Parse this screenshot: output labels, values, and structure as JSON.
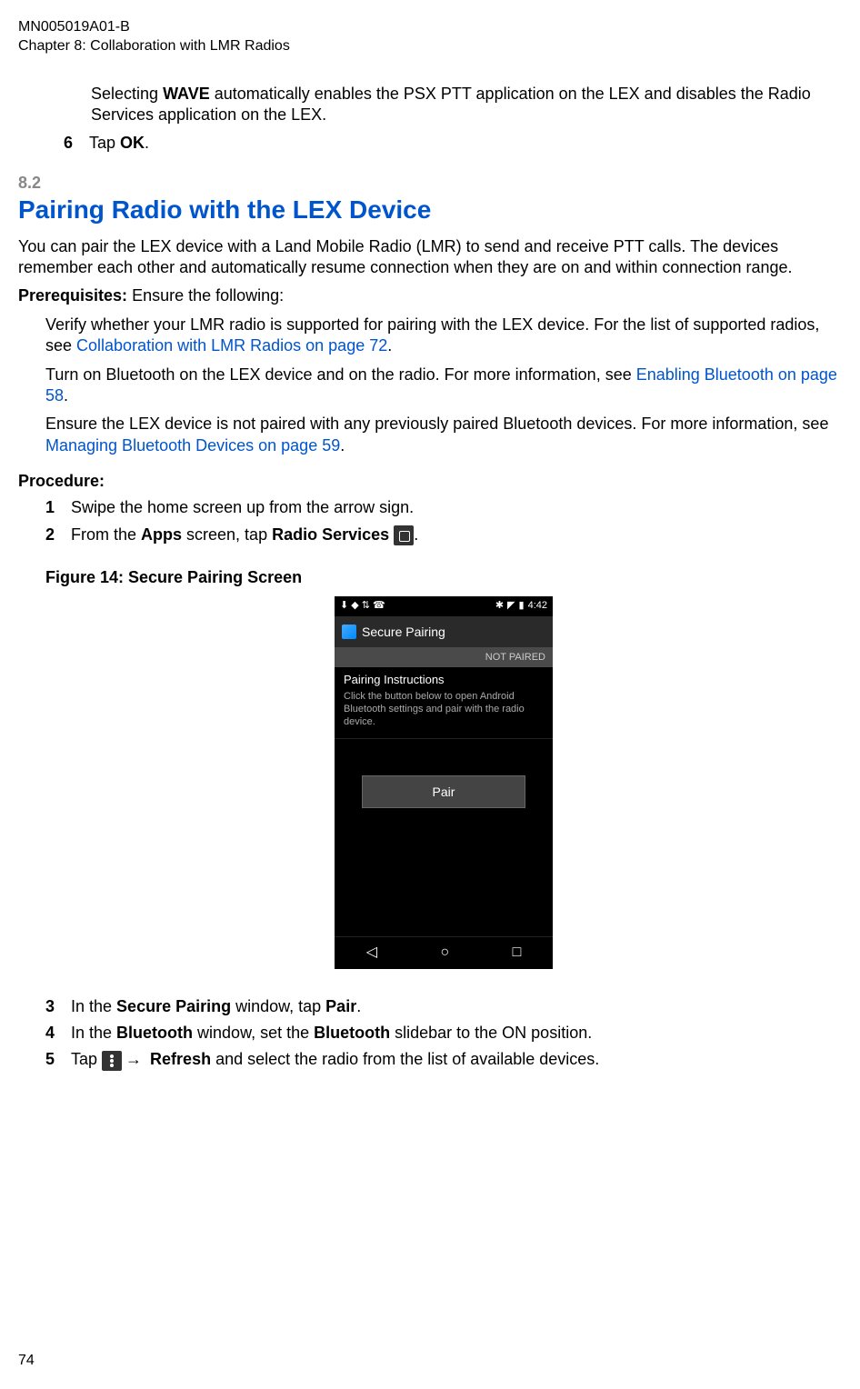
{
  "header": {
    "doc_id": "MN005019A01-B",
    "chapter": "Chapter 8:  Collaboration with LMR Radios"
  },
  "intro": {
    "selecting_text_a": "Selecting ",
    "wave": "WAVE",
    "selecting_text_b": " automatically enables the PSX PTT application on the LEX and disables the Radio Services application on the LEX."
  },
  "step6": {
    "num": "6",
    "text_a": "Tap ",
    "ok": "OK",
    "text_b": "."
  },
  "section": {
    "num": "8.2",
    "title": "Pairing Radio with the LEX Device",
    "desc": "You can pair the LEX device with a Land Mobile Radio (LMR) to send and receive PTT calls. The devices remember each other and automatically resume connection when they are on and within connection range."
  },
  "prereq": {
    "label": "Prerequisites:",
    "ensure": " Ensure the following:",
    "item1_a": "Verify whether your LMR radio is supported for pairing with the LEX device. For the list of supported radios, see ",
    "item1_link": "Collaboration with LMR Radios on page 72",
    "item1_b": ".",
    "item2_a": "Turn on Bluetooth on the LEX device and on the radio. For more information, see ",
    "item2_link": "Enabling Bluetooth on page 58",
    "item2_b": ".",
    "item3_a": "Ensure the LEX device is not paired with any previously paired Bluetooth devices. For more information, see ",
    "item3_link": "Managing Bluetooth Devices on page 59",
    "item3_b": "."
  },
  "procedure": {
    "label": "Procedure:",
    "s1": {
      "num": "1",
      "text": "Swipe the home screen up from the arrow sign."
    },
    "s2": {
      "num": "2",
      "text_a": "From the ",
      "apps": "Apps",
      "text_b": " screen, tap ",
      "rs": "Radio Services",
      "text_c": "."
    },
    "fig_caption": "Figure 14: Secure Pairing Screen",
    "s3": {
      "num": "3",
      "text_a": "In the ",
      "sp": "Secure Pairing",
      "text_b": " window, tap ",
      "pair": "Pair",
      "text_c": "."
    },
    "s4": {
      "num": "4",
      "text_a": "In the ",
      "bt": "Bluetooth",
      "text_b": " window, set the ",
      "bt2": "Bluetooth",
      "text_c": " slidebar to the ON position."
    },
    "s5": {
      "num": "5",
      "text_a": "Tap ",
      "arrow": "→",
      "refresh": "Refresh",
      "text_b": " and select the radio from the list of available devices."
    }
  },
  "phone": {
    "status_left": "⬇ ◆ ⇅ ☎",
    "status_bt": "✱",
    "status_sig": "◤",
    "status_batt": "▮",
    "status_time": "4:42",
    "title": "Secure Pairing",
    "not_paired": "NOT PAIRED",
    "inst_title": "Pairing Instructions",
    "inst_text": "Click the button below to open Android Bluetooth settings and pair with the radio device.",
    "pair_btn": "Pair",
    "nav_back": "◁",
    "nav_home": "○",
    "nav_recent": "□"
  },
  "footer": {
    "page": "74"
  }
}
